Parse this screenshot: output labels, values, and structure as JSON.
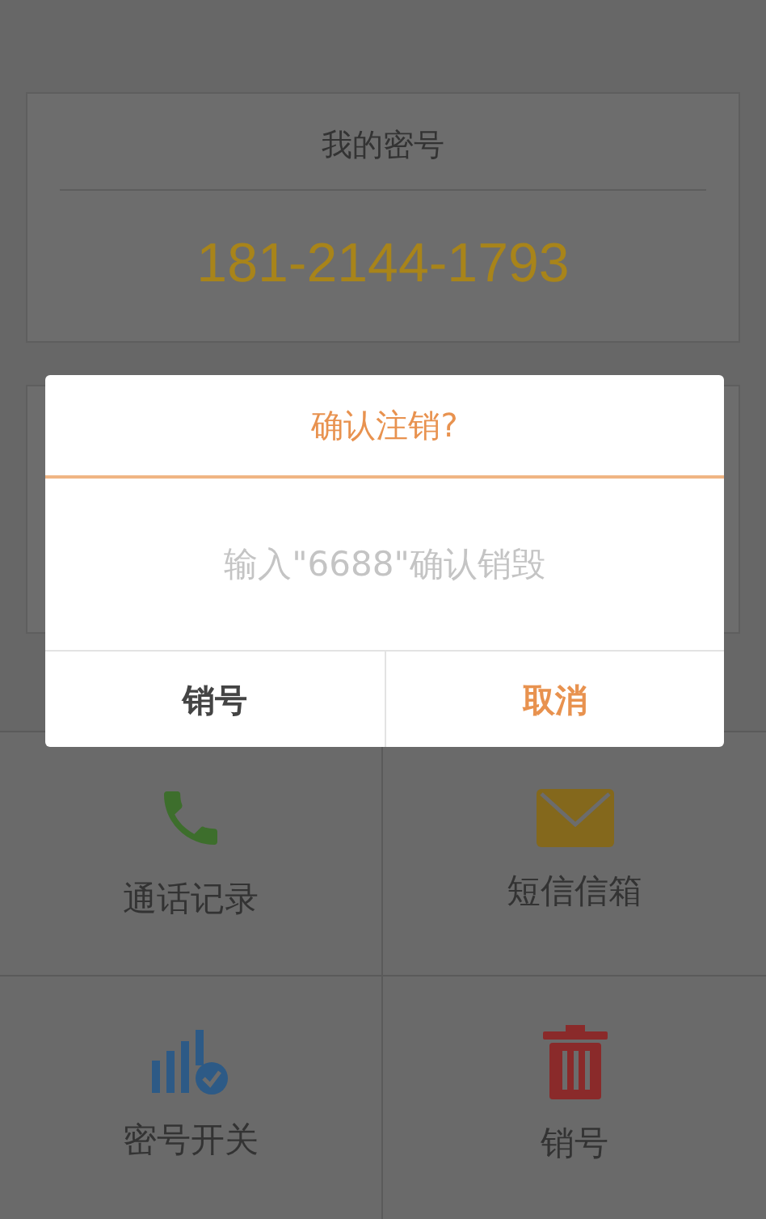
{
  "number_card": {
    "title": "我的密号",
    "number": "181-2144-1793"
  },
  "dialog": {
    "title": "确认注销?",
    "input": {
      "placeholder": "输入\"6688\"确认销毁"
    },
    "buttons": [
      {
        "label": "销号",
        "kind": "plain"
      },
      {
        "label": "取消",
        "kind": "accent"
      }
    ]
  },
  "tiles": [
    {
      "label": "通话记录",
      "kind": "phone"
    },
    {
      "label": "短信信箱",
      "kind": "mail"
    },
    {
      "label": "密号开关",
      "kind": "signal"
    },
    {
      "label": "销号",
      "kind": "trash"
    }
  ]
}
